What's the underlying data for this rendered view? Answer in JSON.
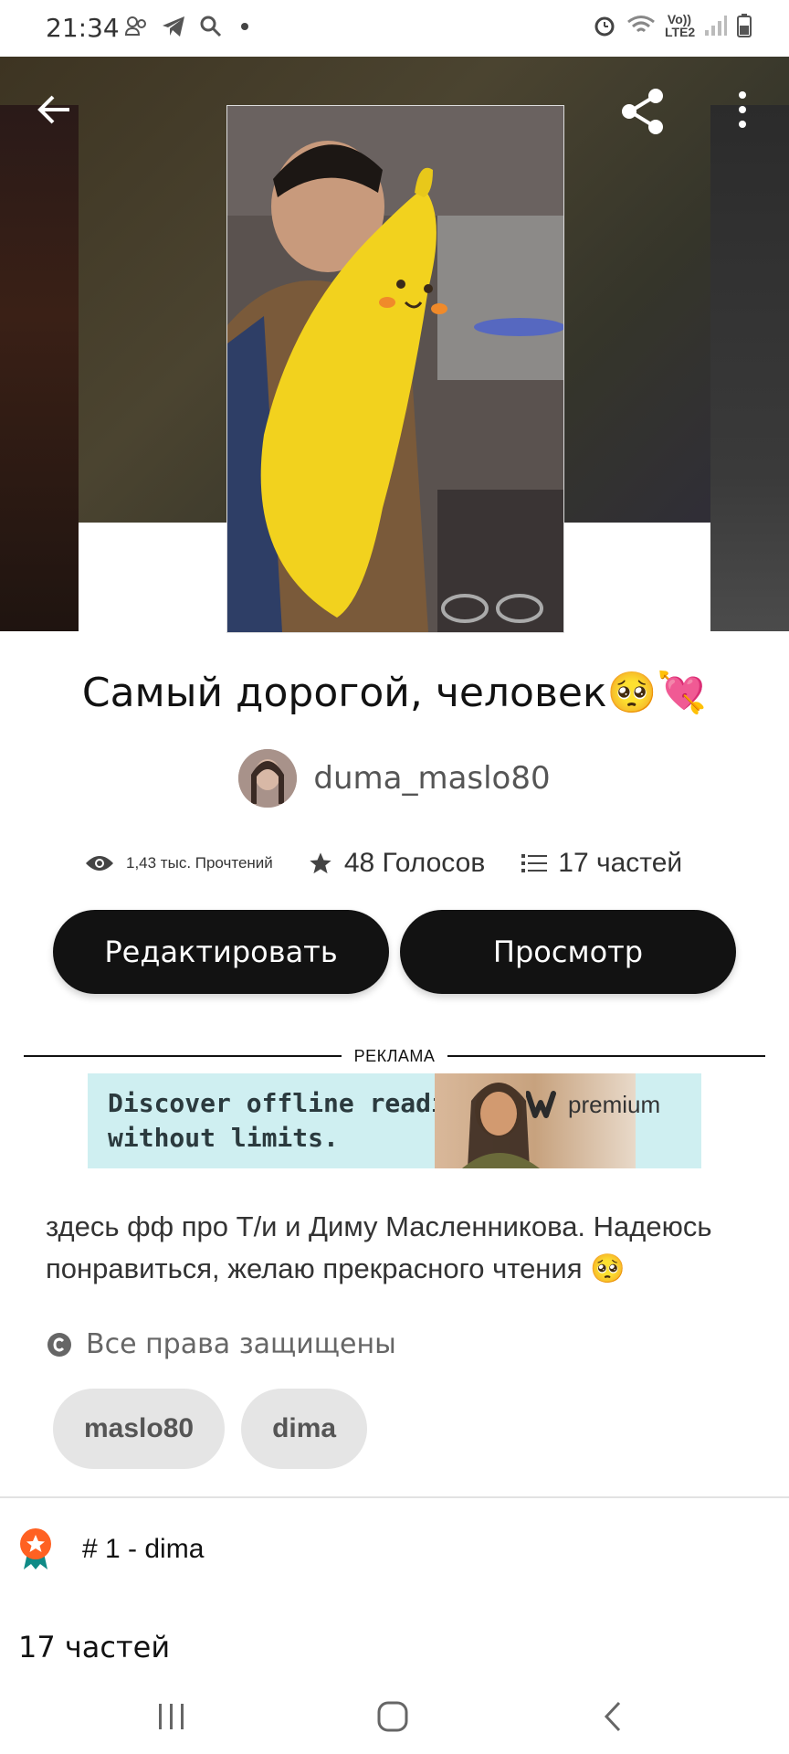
{
  "status_bar": {
    "time": "21:34",
    "network": "Vo)) LTE2",
    "left_icons": [
      "people-icon",
      "telegram-icon",
      "search-icon",
      "dot-icon"
    ],
    "right_icons": [
      "alarm-icon",
      "wifi-icon",
      "signal-icon",
      "battery-icon"
    ]
  },
  "story": {
    "title": "Самый дорогой, человек🥺💘",
    "author": "duma_maslo80",
    "reads": "1,43 тыс. Прочтений",
    "votes": "48 Голосов",
    "parts": "17 частей"
  },
  "actions": {
    "edit_label": "Редактировать",
    "view_label": "Просмотр"
  },
  "ad": {
    "label": "РЕКЛАМА",
    "line1": "Discover offline reading",
    "line2": "without limits.",
    "brand": "premium"
  },
  "description": "здесь фф про Т/и и Диму Масленникова. Надеюсь понравиться, желаю прекрасного чтения 🥺",
  "rights": "Все права защищены",
  "tags": [
    "maslo80",
    "dima"
  ],
  "rank": "# 1 - dima",
  "parts_heading": "17 частей",
  "colors": {
    "button_bg": "#121212",
    "tag_bg": "#e5e5e5",
    "ad_bg": "#cfeff1",
    "rank_badge": "#ff6122"
  }
}
